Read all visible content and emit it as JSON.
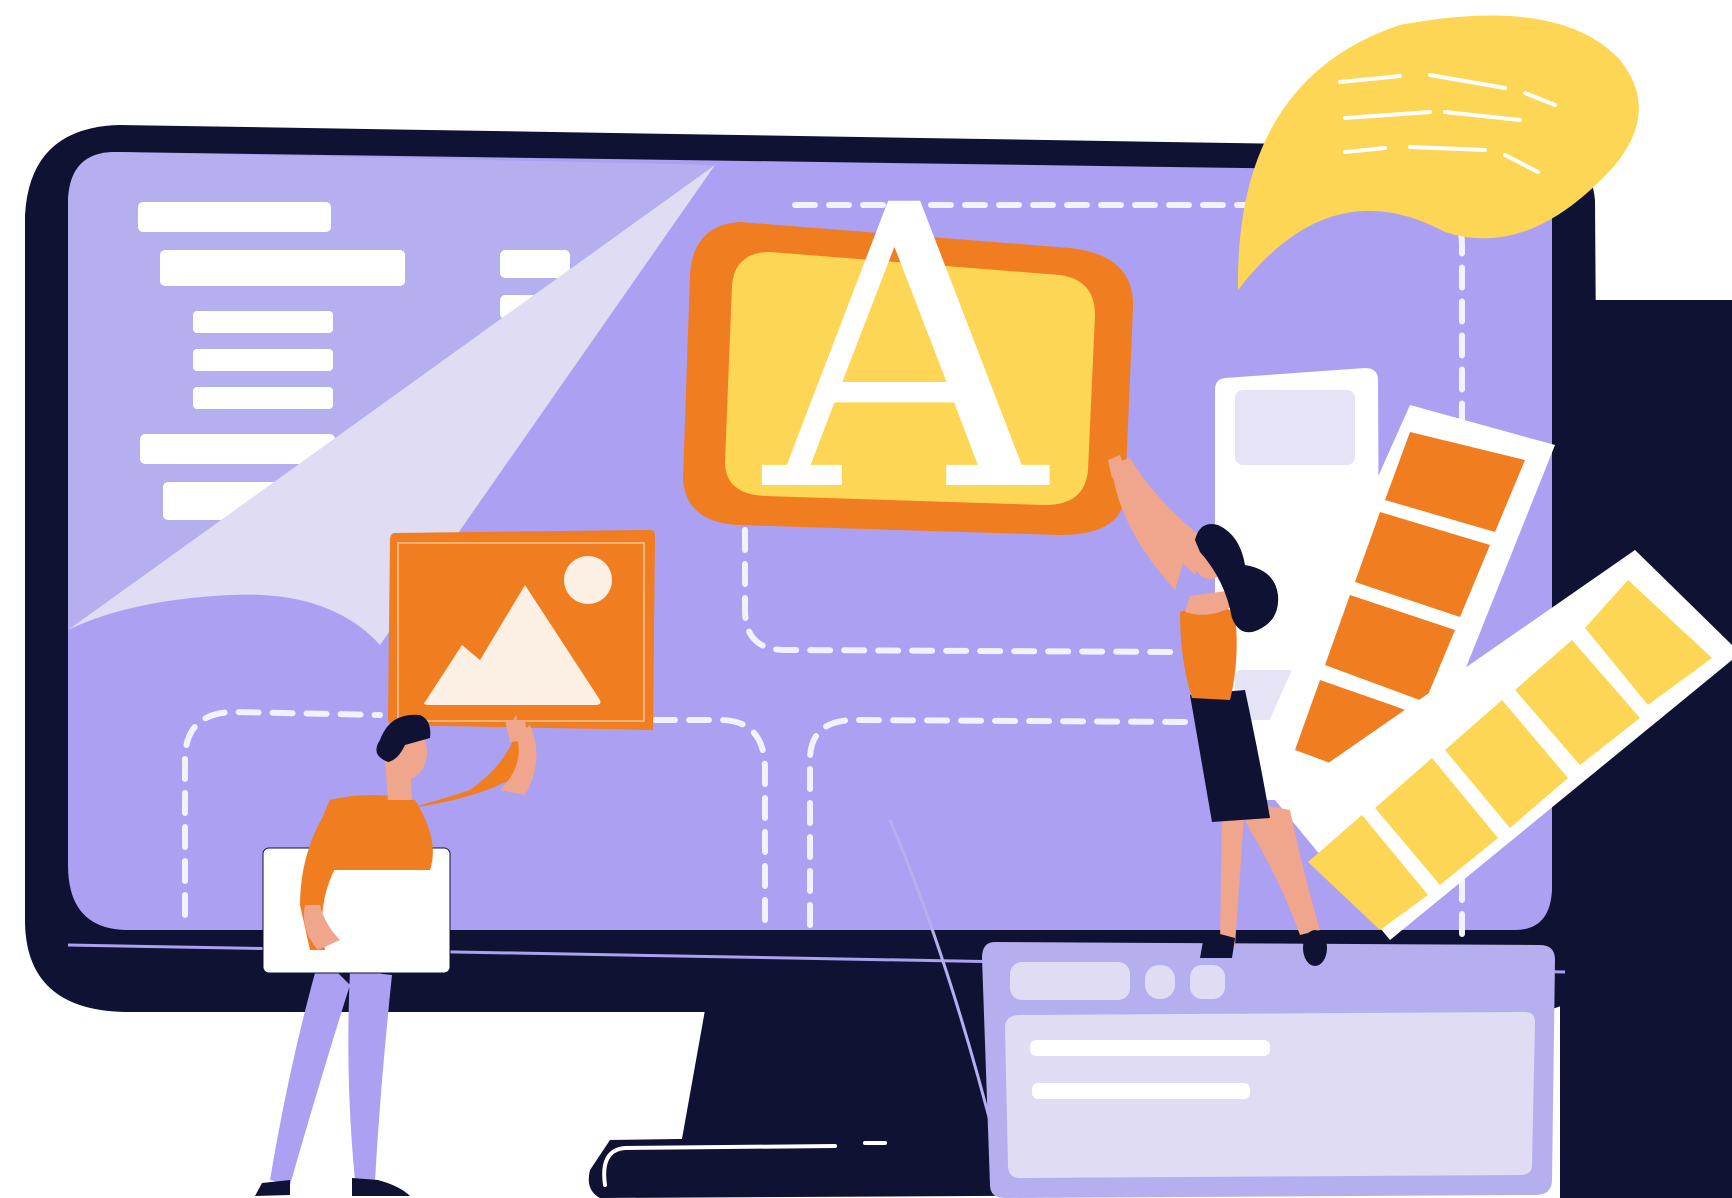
{
  "illustration": {
    "headline_letter": "A",
    "colors": {
      "background": "#ffffff",
      "monitor_frame": "#0f1233",
      "screen": "#aca0f3",
      "screen_light": "#b6afef",
      "page_curl": "#dfdcf3",
      "accent_orange": "#f07d20",
      "accent_yellow": "#fdd655",
      "skin": "#f0a68c",
      "text_lines": "#ffffff"
    },
    "icons": [
      "image-icon",
      "mountain-icon",
      "sun-icon",
      "speech-bubble-icon",
      "color-swatch-icon"
    ]
  }
}
